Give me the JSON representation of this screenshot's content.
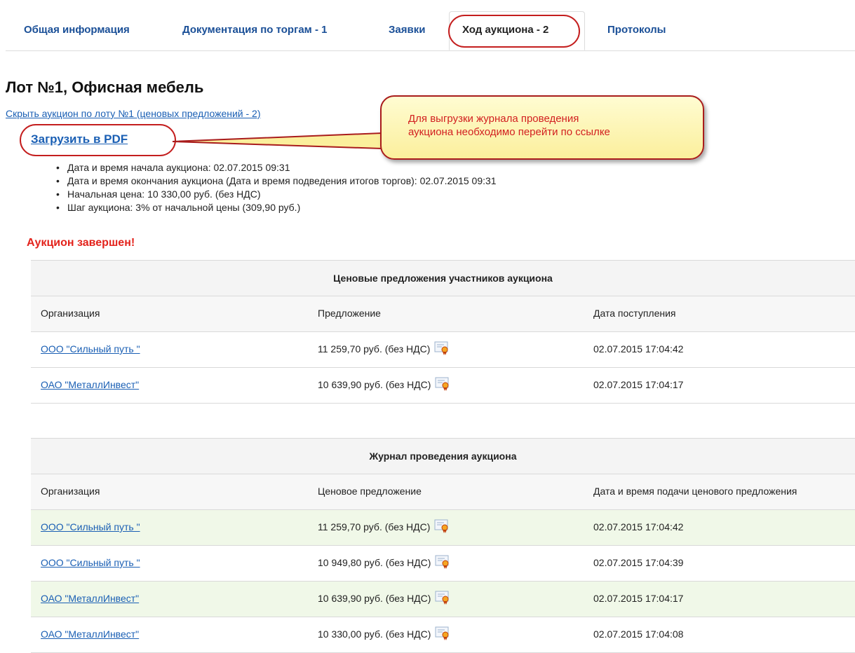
{
  "tabs": [
    {
      "label": "Общая информация"
    },
    {
      "label": "Документация по торгам - 1"
    },
    {
      "label": "Заявки"
    },
    {
      "label": "Ход аукциона - 2"
    },
    {
      "label": "Протоколы"
    }
  ],
  "lot_title": "Лот №1, Офисная мебель",
  "hide_link": "Скрыть аукцион по лоту №1 (ценовых предложений - 2)",
  "pdf_link": "Загрузить в PDF",
  "callout": "Для выгрузки журнала проведения\nаукциона необходимо перейти по ссылке",
  "details": [
    "Дата и время начала аукциона: 02.07.2015 09:31",
    "Дата и время окончания аукциона (Дата и время подведения итогов торгов): 02.07.2015 09:31",
    "Начальная цена: 10 330,00 руб. (без НДС)",
    "Шаг аукциона: 3% от начальной цены (309,90 руб.)"
  ],
  "status": "Аукцион завершен!",
  "bids_table": {
    "title": "Ценовые предложения участников аукциона",
    "columns": [
      "Организация",
      "Предложение",
      "Дата поступления"
    ],
    "rows": [
      {
        "org": "ООО \"Сильный путь \"",
        "offer": "11 259,70 руб. (без НДС)",
        "date": "02.07.2015 17:04:42"
      },
      {
        "org": "ОАО \"МеталлИнвест\"",
        "offer": "10 639,90 руб. (без НДС)",
        "date": "02.07.2015 17:04:17"
      }
    ]
  },
  "log_table": {
    "title": "Журнал проведения аукциона",
    "columns": [
      "Организация",
      "Ценовое предложение",
      "Дата и время подачи ценового предложения"
    ],
    "rows": [
      {
        "org": "ООО \"Сильный путь \"",
        "offer": "11 259,70 руб. (без НДС)",
        "date": "02.07.2015 17:04:42"
      },
      {
        "org": "ООО \"Сильный путь \"",
        "offer": "10 949,80 руб. (без НДС)",
        "date": "02.07.2015 17:04:39"
      },
      {
        "org": "ОАО \"МеталлИнвест\"",
        "offer": "10 639,90 руб. (без НДС)",
        "date": "02.07.2015 17:04:17"
      },
      {
        "org": "ОАО \"МеталлИнвест\"",
        "offer": "10 330,00 руб. (без НДС)",
        "date": "02.07.2015 17:04:08"
      }
    ]
  },
  "colors": {
    "accent": "#1a5fb4",
    "alert": "#e3231c",
    "highlight_oval": "#c41e1e"
  }
}
